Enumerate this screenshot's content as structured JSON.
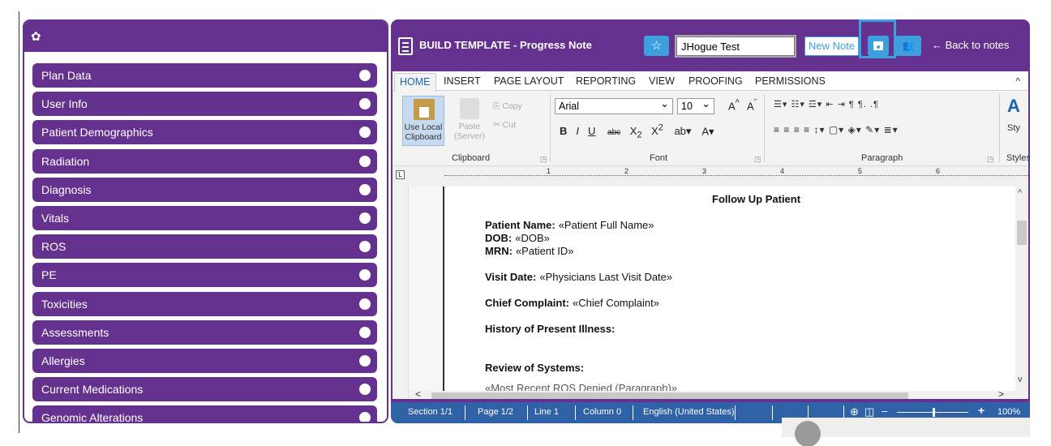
{
  "left_panel": {
    "header_icon": "gear-icon",
    "items": [
      {
        "label": "Plan Data"
      },
      {
        "label": "User Info"
      },
      {
        "label": "Patient Demographics"
      },
      {
        "label": "Radiation"
      },
      {
        "label": "Diagnosis"
      },
      {
        "label": "Vitals"
      },
      {
        "label": "ROS"
      },
      {
        "label": "PE"
      },
      {
        "label": "Toxicities"
      },
      {
        "label": "Assessments"
      },
      {
        "label": "Allergies"
      },
      {
        "label": "Current Medications"
      },
      {
        "label": "Genomic Alterations"
      }
    ]
  },
  "header": {
    "title": "BUILD TEMPLATE - Progress Note",
    "template_name_value": "JHogue Test",
    "new_note_label": "New Note",
    "back_label": "← Back to notes"
  },
  "ribbon": {
    "tabs": [
      "HOME",
      "INSERT",
      "PAGE LAYOUT",
      "REPORTING",
      "VIEW",
      "PROOFING",
      "PERMISSIONS"
    ],
    "active_tab": "HOME",
    "clipboard": {
      "use_local": "Use Local Clipboard",
      "paste": "Paste (Server)",
      "copy": "Copy",
      "cut": "Cut",
      "group_label": "Clipboard"
    },
    "font": {
      "family": "Arial",
      "size": "10",
      "group_label": "Font"
    },
    "paragraph": {
      "group_label": "Paragraph"
    },
    "styles": {
      "group_label": "Styles",
      "short": "Sty"
    }
  },
  "ruler": {
    "numbers": [
      "1",
      "2",
      "3",
      "4",
      "5",
      "6"
    ]
  },
  "document": {
    "title": "Follow Up Patient",
    "patient_name_label": "Patient Name:",
    "patient_name_field": "«Patient Full Name»",
    "dob_label": "DOB:",
    "dob_field": "«DOB»",
    "mrn_label": "MRN:",
    "mrn_field": "«Patient ID»",
    "visit_date_label": "Visit Date:",
    "visit_date_field": "«Physicians Last Visit Date»",
    "chief_complaint_label": "Chief Complaint:",
    "chief_complaint_field": "«Chief Complaint»",
    "hpi_label": "History of Present Illness:",
    "ros_label": "Review of Systems:",
    "cut_line": "«Most Recent ROS Denied (Paragraph)»"
  },
  "status_bar": {
    "section": "Section 1/1",
    "page": "Page 1/2",
    "line": "Line 1",
    "column": "Column 0",
    "language": "English (United States)",
    "zoom": "100%"
  },
  "colors": {
    "brand_purple": "#65318e",
    "accent_blue": "#3da0dd",
    "status_blue": "#2f61a6"
  }
}
